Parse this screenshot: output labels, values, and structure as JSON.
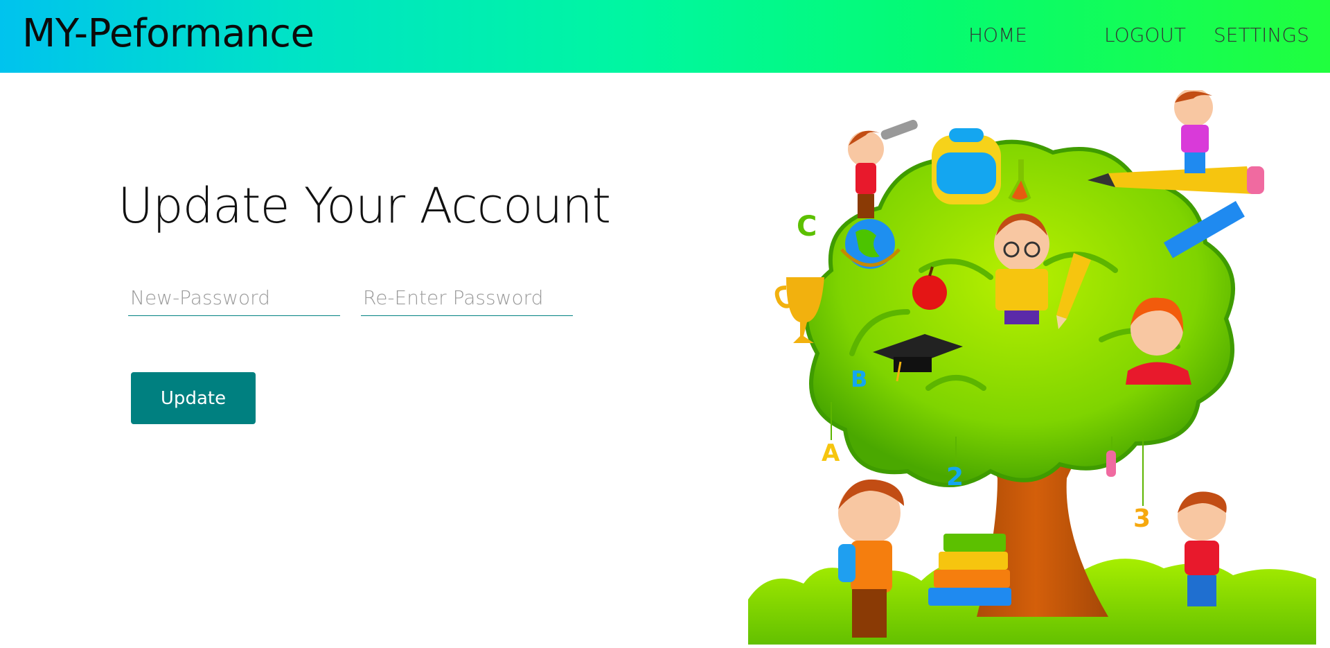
{
  "header": {
    "brand": "MY-Peformance",
    "nav": {
      "home": "HOME",
      "logout": "LOGOUT",
      "settings": "SETTINGS"
    }
  },
  "form": {
    "title": "Update Your Account",
    "new_password": {
      "placeholder": "New-Password",
      "value": ""
    },
    "re_password": {
      "placeholder": "Re-Enter Password",
      "value": ""
    },
    "submit_label": "Update"
  },
  "illustration": {
    "subject": "cartoon-learning-tree-with-children"
  },
  "colors": {
    "accent": "#008080",
    "header_gradient_start": "#00c3ee",
    "header_gradient_end": "#20ff3e"
  }
}
